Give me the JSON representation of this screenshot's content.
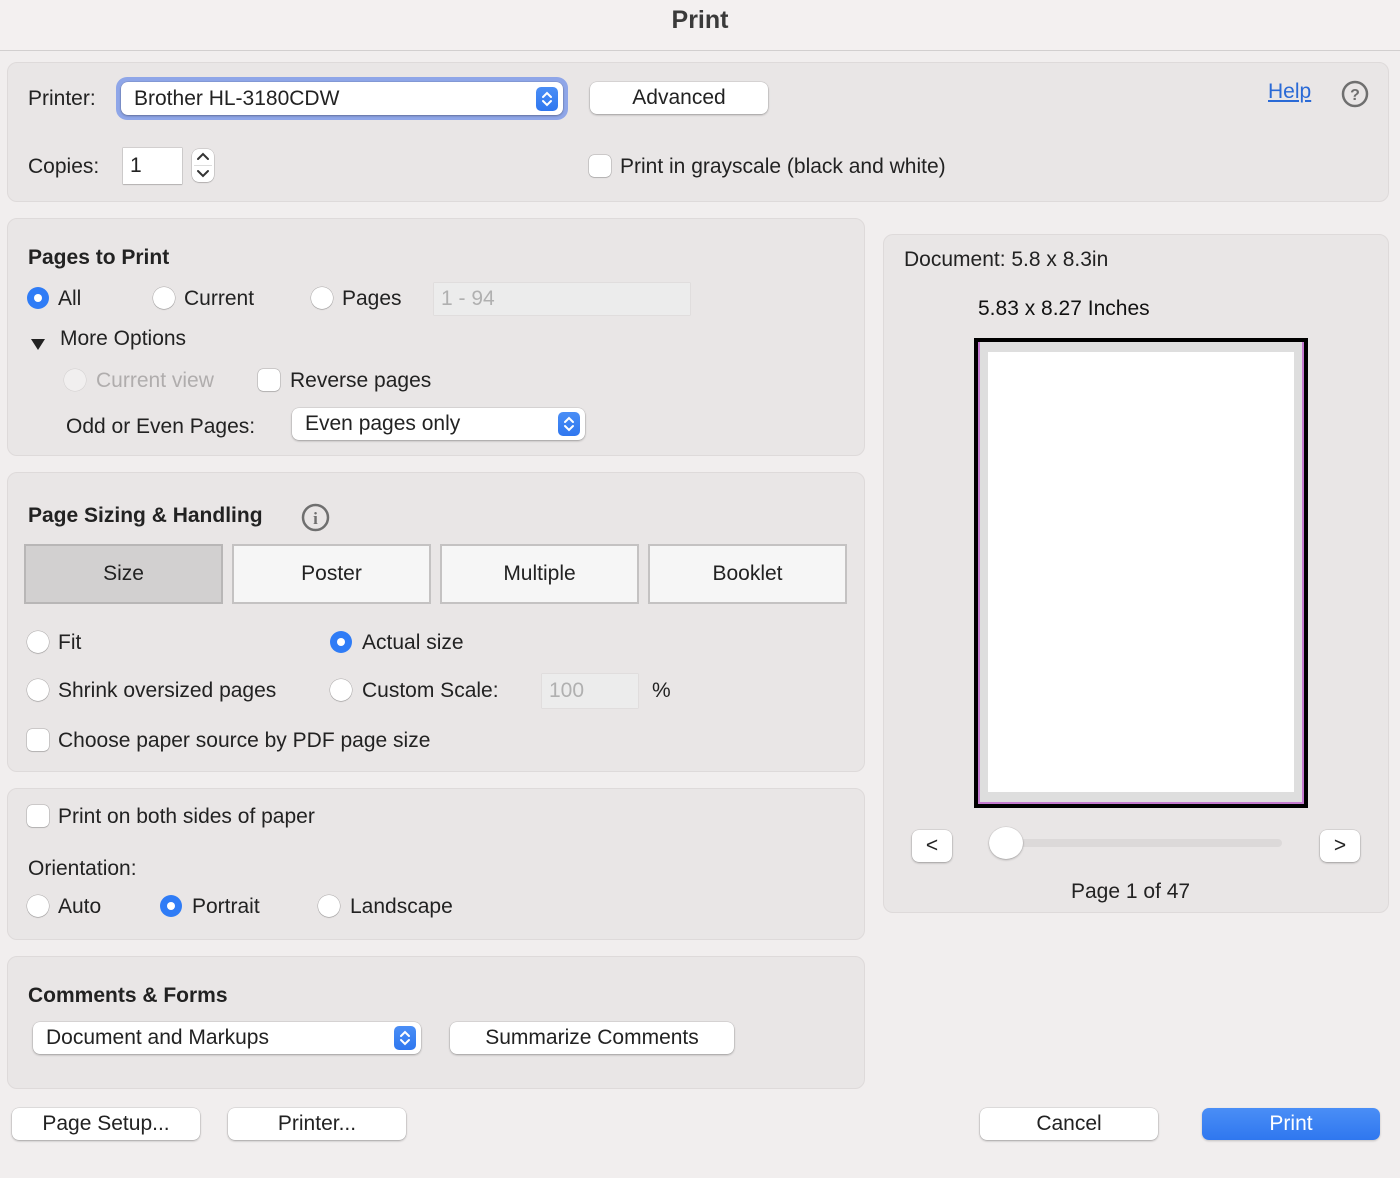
{
  "window": {
    "title": "Print"
  },
  "printer_section": {
    "printer_label": "Printer:",
    "printer_value": "Brother HL-3180CDW",
    "advanced_label": "Advanced",
    "help_label": "Help",
    "copies_label": "Copies:",
    "copies_value": "1",
    "grayscale_label": "Print in grayscale (black and white)",
    "grayscale_checked": false
  },
  "pages_to_print": {
    "heading": "Pages to Print",
    "options": [
      {
        "label": "All",
        "selected": true
      },
      {
        "label": "Current",
        "selected": false
      },
      {
        "label": "Pages",
        "selected": false
      }
    ],
    "pages_range_placeholder": "1 - 94",
    "more_options_label": "More Options",
    "current_view_label": "Current view",
    "reverse_pages_label": "Reverse pages",
    "reverse_pages_checked": false,
    "odd_even_label": "Odd or Even Pages:",
    "odd_even_value": "Even pages only"
  },
  "page_sizing": {
    "heading": "Page Sizing & Handling",
    "tabs": [
      {
        "label": "Size",
        "active": true
      },
      {
        "label": "Poster",
        "active": false
      },
      {
        "label": "Multiple",
        "active": false
      },
      {
        "label": "Booklet",
        "active": false
      }
    ],
    "fit_label": "Fit",
    "actual_size_label": "Actual size",
    "shrink_label": "Shrink oversized pages",
    "custom_scale_label": "Custom Scale:",
    "custom_scale_value": "100",
    "percent_sign": "%",
    "selected_option": "Actual size",
    "paper_source_label": "Choose paper source by PDF page size",
    "paper_source_checked": false
  },
  "duplex_orientation": {
    "both_sides_label": "Print on both sides of paper",
    "both_sides_checked": false,
    "orientation_label": "Orientation:",
    "options": [
      {
        "label": "Auto",
        "selected": false
      },
      {
        "label": "Portrait",
        "selected": true
      },
      {
        "label": "Landscape",
        "selected": false
      }
    ]
  },
  "comments_forms": {
    "heading": "Comments & Forms",
    "select_value": "Document and Markups",
    "summarize_label": "Summarize Comments"
  },
  "preview": {
    "document_size": "Document: 5.8 x 8.3in",
    "paper_size": "5.83 x 8.27 Inches",
    "prev_label": "<",
    "next_label": ">",
    "page_indicator": "Page 1 of 47",
    "current_page": 1,
    "total_pages": 47
  },
  "footer": {
    "page_setup_label": "Page Setup...",
    "printer_label": "Printer...",
    "cancel_label": "Cancel",
    "print_label": "Print"
  },
  "colors": {
    "accent": "#2f7cf6",
    "link": "#2a6ad6",
    "preview_margin": "#c47ad0"
  }
}
